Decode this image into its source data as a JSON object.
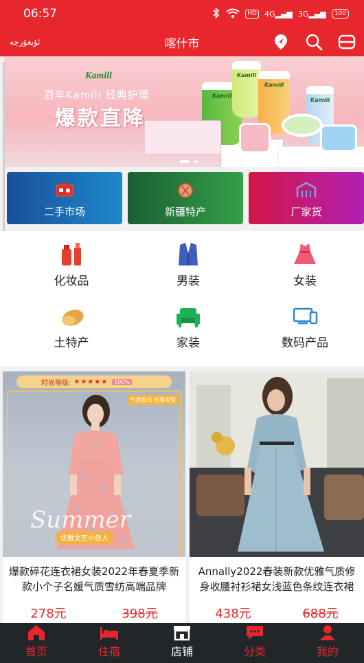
{
  "status": {
    "time": "06:57",
    "network": "4G",
    "network2": "3G",
    "hd": "HD",
    "battery": "100"
  },
  "nav": {
    "lang_label": "ئۇيغۇرچە",
    "title": "喀什市"
  },
  "banner": {
    "brand": "Kamill",
    "tagline": "百年Kamill 经典护理",
    "headline": "爆款直降"
  },
  "categories": [
    {
      "label": "二手市场",
      "icon": "market-icon"
    },
    {
      "label": "新疆特产",
      "icon": "specialty-icon"
    },
    {
      "label": "厂家货",
      "icon": "factory-icon"
    }
  ],
  "grid": [
    {
      "label": "化妆品",
      "icon": "cosmetics-icon"
    },
    {
      "label": "男装",
      "icon": "menswear-icon"
    },
    {
      "label": "女装",
      "icon": "womenswear-icon"
    },
    {
      "label": "土特产",
      "icon": "local-produce-icon"
    },
    {
      "label": "家装",
      "icon": "home-decor-icon"
    },
    {
      "label": "数码产品",
      "icon": "digital-icon"
    }
  ],
  "products": [
    {
      "name": "爆款碎花连衣裙女装2022年春夏季新款小个子名媛气质雪纺高端品牌",
      "price": "278元",
      "old_price": "398元",
      "ribbon": "时尚等级:",
      "stars": "★★★★★",
      "ribbon_chip": "100%",
      "sticker": "气质显白 纤腰有型",
      "overlay_text": "Summer",
      "promo": "优雅文艺小佳人"
    },
    {
      "name": "Annally2022春装新款优雅气质修身收腰衬衫裙女浅蓝色条纹连衣裙",
      "price": "438元",
      "old_price": "688元"
    }
  ],
  "tabs": [
    {
      "label": "首页",
      "icon": "home-icon"
    },
    {
      "label": "住宿",
      "icon": "bed-icon"
    },
    {
      "label": "店铺",
      "icon": "shop-icon"
    },
    {
      "label": "分类",
      "icon": "chat-icon"
    },
    {
      "label": "我的",
      "icon": "user-icon"
    }
  ],
  "colors": {
    "primary": "#e8262d",
    "tabbar": "#232628"
  }
}
